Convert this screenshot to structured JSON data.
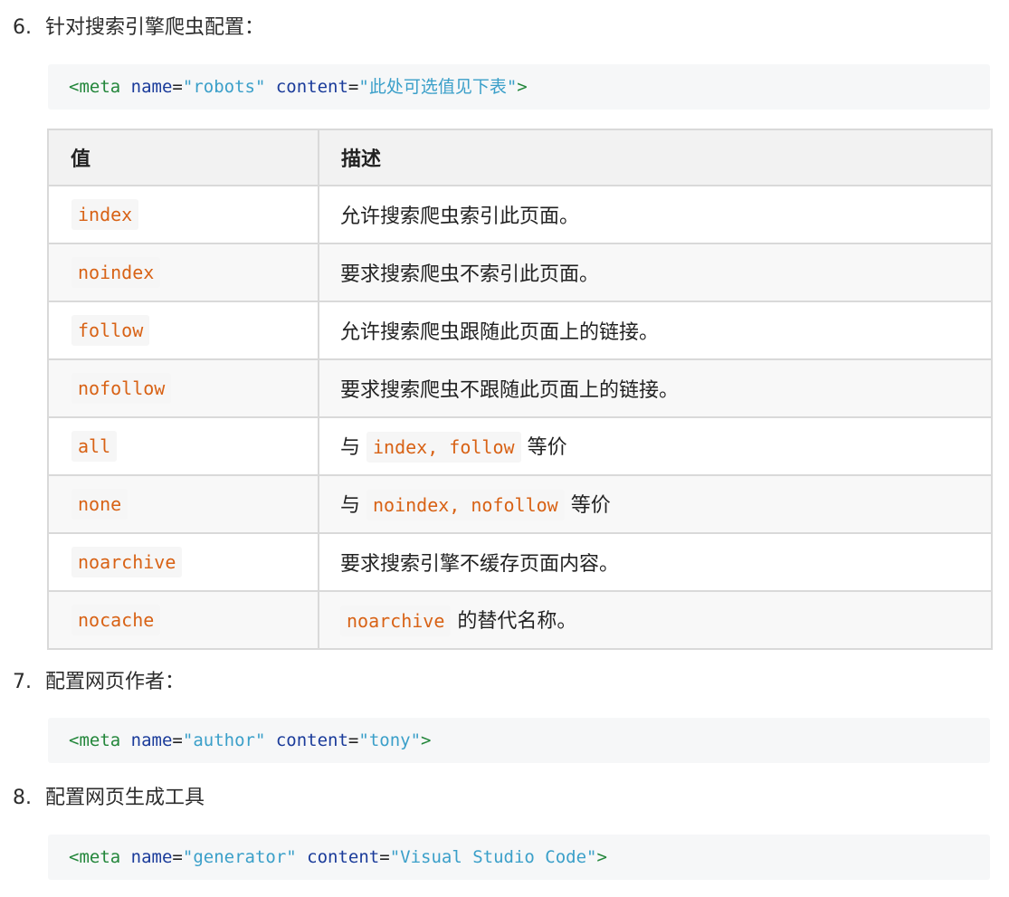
{
  "sections": [
    {
      "number": "6.",
      "title": "针对搜索引擎爬虫配置：",
      "code": {
        "tag_open": "<meta",
        "attr1_name": "name",
        "attr1_value": "\"robots\"",
        "attr2_name": "content",
        "attr2_value": "\"此处可选值见下表\"",
        "tag_close": ">"
      }
    },
    {
      "number": "7.",
      "title": "配置网页作者：",
      "code": {
        "tag_open": "<meta",
        "attr1_name": "name",
        "attr1_value": "\"author\"",
        "attr2_name": "content",
        "attr2_value": "\"tony\"",
        "tag_close": ">"
      }
    },
    {
      "number": "8.",
      "title": "配置网页生成工具",
      "code": {
        "tag_open": "<meta",
        "attr1_name": "name",
        "attr1_value": "\"generator\"",
        "attr2_name": "content",
        "attr2_value": "\"Visual Studio Code\"",
        "tag_close": ">"
      }
    }
  ],
  "table": {
    "headers": [
      "值",
      "描述"
    ],
    "rows": [
      {
        "value": "index",
        "desc": "允许搜索爬虫索引此页面。"
      },
      {
        "value": "noindex",
        "desc": "要求搜索爬虫不索引此页面。"
      },
      {
        "value": "follow",
        "desc": "允许搜索爬虫跟随此页面上的链接。"
      },
      {
        "value": "nofollow",
        "desc": "要求搜索爬虫不跟随此页面上的链接。"
      },
      {
        "value": "all",
        "desc_prefix": "与",
        "desc_code": "index, follow",
        "desc_suffix": "等价"
      },
      {
        "value": "none",
        "desc_prefix": "与",
        "desc_code": "noindex, nofollow",
        "desc_suffix": "等价"
      },
      {
        "value": "noarchive",
        "desc": "要求搜索引擎不缓存页面内容。"
      },
      {
        "value": "nocache",
        "desc_code": "noarchive",
        "desc_suffix": "的替代名称。"
      }
    ]
  },
  "colors": {
    "code_background": "#f6f7f8",
    "tag": "#22863a",
    "attribute": "#1a3b9a",
    "string": "#3a9fc9",
    "inline_code": "#d86215",
    "table_border": "#d9d9d9",
    "table_header_bg": "#f2f2f2"
  }
}
